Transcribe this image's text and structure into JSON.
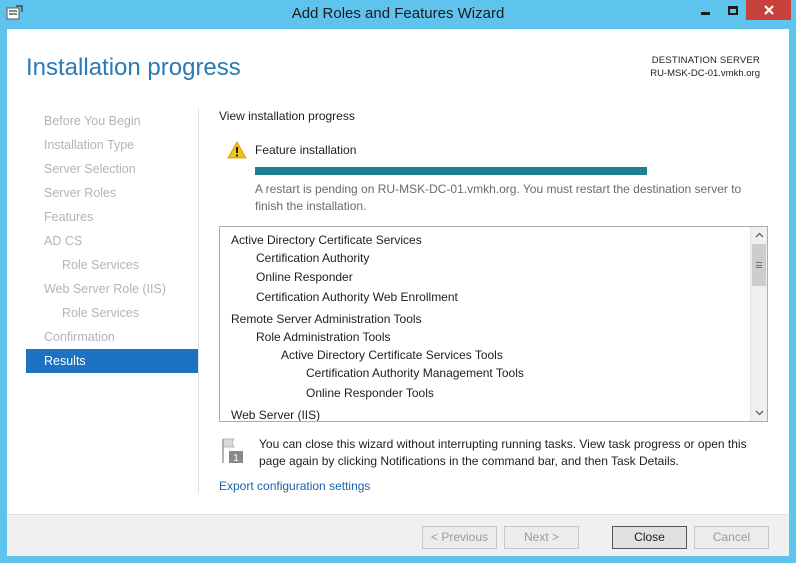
{
  "window": {
    "title": "Add Roles and Features Wizard"
  },
  "header": {
    "page_title": "Installation progress",
    "destination_label": "DESTINATION SERVER",
    "destination_server": "RU-MSK-DC-01.vmkh.org"
  },
  "nav": {
    "items": [
      {
        "label": "Before You Begin"
      },
      {
        "label": "Installation Type"
      },
      {
        "label": "Server Selection"
      },
      {
        "label": "Server Roles"
      },
      {
        "label": "Features"
      },
      {
        "label": "AD CS"
      },
      {
        "label": "Role Services"
      },
      {
        "label": "Web Server Role (IIS)"
      },
      {
        "label": "Role Services"
      },
      {
        "label": "Confirmation"
      },
      {
        "label": "Results"
      }
    ]
  },
  "main": {
    "heading": "View installation progress",
    "feature_label": "Feature installation",
    "progress_percent": 100,
    "restart_message": "A restart is pending on RU-MSK-DC-01.vmkh.org. You must restart the destination server to finish the installation.",
    "results": [
      {
        "label": "Active Directory Certificate Services"
      },
      {
        "label": "Certification Authority"
      },
      {
        "label": "Online Responder"
      },
      {
        "label": "Certification Authority Web Enrollment"
      },
      {
        "label": "Remote Server Administration Tools"
      },
      {
        "label": "Role Administration Tools"
      },
      {
        "label": "Active Directory Certificate Services Tools"
      },
      {
        "label": "Certification Authority Management Tools"
      },
      {
        "label": "Online Responder Tools"
      },
      {
        "label": "Web Server (IIS)"
      }
    ],
    "notification": "You can close this wizard without interrupting running tasks. View task progress or open this page again by clicking Notifications in the command bar, and then Task Details.",
    "notification_badge": "1",
    "export_link": "Export configuration settings"
  },
  "footer": {
    "previous": "< Previous",
    "next": "Next >",
    "close": "Close",
    "cancel": "Cancel"
  },
  "colors": {
    "accent": "#1c71c2",
    "title": "#2a7ab3",
    "progress": "#1e7f93",
    "link": "#1c62a8",
    "close_button": "#c7423a"
  }
}
